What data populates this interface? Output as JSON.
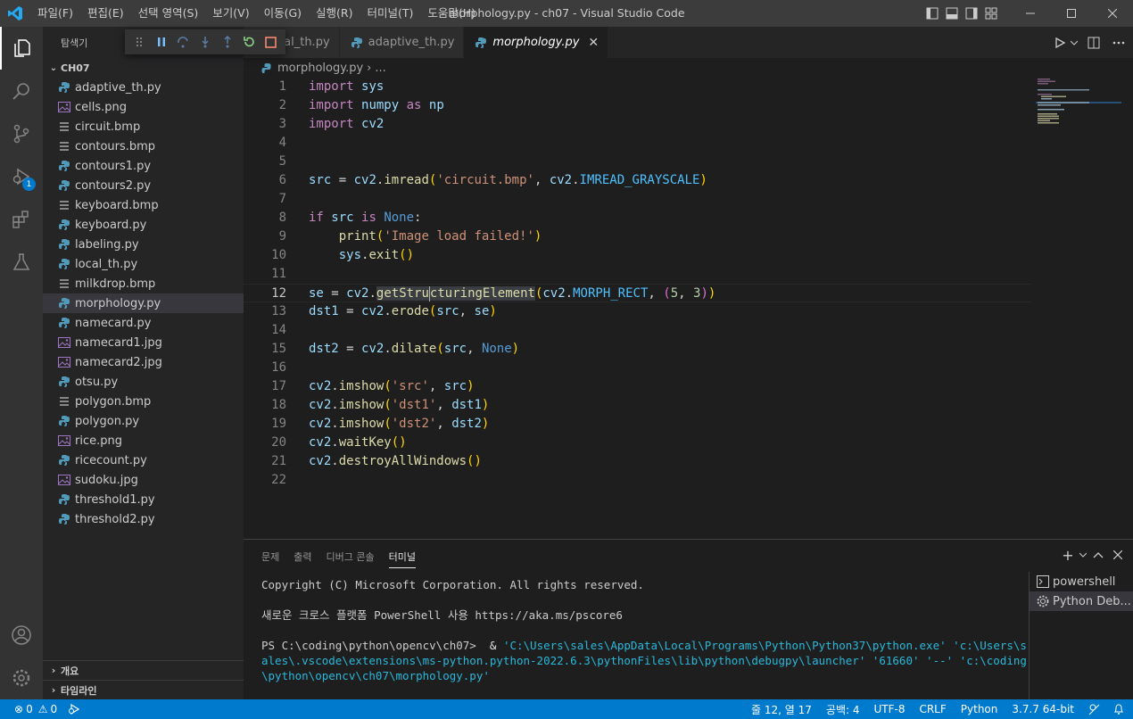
{
  "titlebar": {
    "title": "morphology.py - ch07 - Visual Studio Code",
    "menu": [
      "파일(F)",
      "편집(E)",
      "선택 영역(S)",
      "보기(V)",
      "이동(G)",
      "실행(R)",
      "터미널(T)",
      "도움말(H)"
    ]
  },
  "sidebar": {
    "header": "탐색기",
    "folder": "CH07",
    "files": [
      {
        "name": "adaptive_th.py",
        "icon": "python-file-icon"
      },
      {
        "name": "cells.png",
        "icon": "image-file-icon"
      },
      {
        "name": "circuit.bmp",
        "icon": "text-file-icon"
      },
      {
        "name": "contours.bmp",
        "icon": "text-file-icon"
      },
      {
        "name": "contours1.py",
        "icon": "python-file-icon"
      },
      {
        "name": "contours2.py",
        "icon": "python-file-icon"
      },
      {
        "name": "keyboard.bmp",
        "icon": "text-file-icon"
      },
      {
        "name": "keyboard.py",
        "icon": "python-file-icon"
      },
      {
        "name": "labeling.py",
        "icon": "python-file-icon"
      },
      {
        "name": "local_th.py",
        "icon": "python-file-icon"
      },
      {
        "name": "milkdrop.bmp",
        "icon": "text-file-icon"
      },
      {
        "name": "morphology.py",
        "icon": "python-file-icon"
      },
      {
        "name": "namecard.py",
        "icon": "python-file-icon"
      },
      {
        "name": "namecard1.jpg",
        "icon": "image-file-icon"
      },
      {
        "name": "namecard2.jpg",
        "icon": "image-file-icon"
      },
      {
        "name": "otsu.py",
        "icon": "python-file-icon"
      },
      {
        "name": "polygon.bmp",
        "icon": "text-file-icon"
      },
      {
        "name": "polygon.py",
        "icon": "python-file-icon"
      },
      {
        "name": "rice.png",
        "icon": "image-file-icon"
      },
      {
        "name": "ricecount.py",
        "icon": "python-file-icon"
      },
      {
        "name": "sudoku.jpg",
        "icon": "image-file-icon"
      },
      {
        "name": "threshold1.py",
        "icon": "python-file-icon"
      },
      {
        "name": "threshold2.py",
        "icon": "python-file-icon"
      }
    ],
    "selected_file": "morphology.py",
    "outline": "개요",
    "timeline": "타임라인"
  },
  "activity": {
    "debug_badge": "1"
  },
  "tabs": [
    {
      "label": "cal_th.py",
      "active": false
    },
    {
      "label": "adaptive_th.py",
      "active": false
    },
    {
      "label": "morphology.py",
      "active": true
    }
  ],
  "breadcrumb": {
    "file": "morphology.py",
    "ellipsis": "..."
  },
  "editor": {
    "current_line": 12,
    "line_numbers": [
      "1",
      "2",
      "3",
      "4",
      "5",
      "6",
      "7",
      "8",
      "9",
      "10",
      "11",
      "12",
      "13",
      "14",
      "15",
      "16",
      "17",
      "18",
      "19",
      "20",
      "21",
      "22"
    ],
    "lines": [
      "import sys",
      "import numpy as np",
      "import cv2",
      "",
      "",
      "src = cv2.imread('circuit.bmp', cv2.IMREAD_GRAYSCALE)",
      "",
      "if src is None:",
      "    print('Image load failed!')",
      "    sys.exit()",
      "",
      "se = cv2.getStructuringElement(cv2.MORPH_RECT, (5, 3))",
      "dst1 = cv2.erode(src, se)",
      "",
      "dst2 = cv2.dilate(src, None)",
      "",
      "cv2.imshow('src', src)",
      "cv2.imshow('dst1', dst1)",
      "cv2.imshow('dst2', dst2)",
      "cv2.waitKey()",
      "cv2.destroyAllWindows()",
      ""
    ]
  },
  "panel": {
    "tabs": [
      "문제",
      "출력",
      "디버그 콘솔",
      "터미널"
    ],
    "active_tab": "터미널",
    "terminal": {
      "line1": "Copyright (C) Microsoft Corporation. All rights reserved.",
      "line2": "새로운 크로스 플랫폼 PowerShell 사용 https://aka.ms/pscore6",
      "prompt": "PS C:\\coding\\python\\opencv\\ch07> ",
      "amp": " & ",
      "cmd_exe": "'C:\\Users\\sales\\AppData\\Local\\Programs\\Python\\Python37\\python.exe'",
      "cmd_rest": " 'c:\\Users\\sales\\.vscode\\extensions\\ms-python.python-2022.6.3\\pythonFiles\\lib\\python\\debugpy\\launcher' '61660' '--' 'c:\\coding\\python\\opencv\\ch07\\morphology.py'"
    },
    "terminals": [
      "powershell",
      "Python Deb..."
    ]
  },
  "statusbar": {
    "errors": "0",
    "warnings": "0",
    "position": "줄 12, 열 17",
    "spaces": "공백: 4",
    "encoding": "UTF-8",
    "eol": "CRLF",
    "language": "Python",
    "interpreter": "3.7.7 64-bit"
  },
  "colors": {
    "accent": "#007acc",
    "activitybar": "#333333",
    "sidebar": "#252526",
    "editor": "#1e1e1e",
    "python_icon": "#519aba",
    "image_icon": "#a074c4"
  }
}
